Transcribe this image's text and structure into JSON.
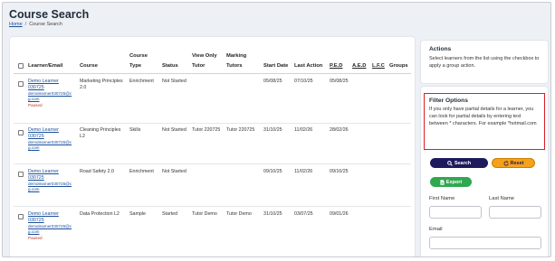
{
  "page": {
    "title": "Course Search",
    "breadcrumb": {
      "home": "Home",
      "separator": "/",
      "current": "Course Search"
    }
  },
  "table": {
    "headers": {
      "learner": "Learner/Email",
      "course": "Course",
      "course_type_1": "Course",
      "course_type_2": "Type",
      "status": "Status",
      "view_only_1": "View Only",
      "view_only_2": "Tutor",
      "marking_1": "Marking",
      "marking_2": "Tutors",
      "start_date": "Start Date",
      "last_action": "Last Action",
      "ped": "P.E.D",
      "aed": "A.E.D",
      "lfc": "L.F.C",
      "groups": "Groups"
    },
    "rows": [
      {
        "learner_name_1": "Demo Learner",
        "learner_name_2": "030725",
        "email_1": "demolearner030725@c",
        "email_2": "g.com",
        "flag": "Paused",
        "course_1": "Marketing Principles",
        "course_2": "2.0",
        "type": "Enrichment",
        "status": "Not Started",
        "view_only": "",
        "marking": "",
        "start": "05/08/25",
        "last_action": "07/10/25",
        "ped": "05/08/25",
        "aed": "",
        "lfc": "",
        "groups": ""
      },
      {
        "learner_name_1": "Demo Learner",
        "learner_name_2": "030725",
        "email_1": "demolearner030725@c",
        "email_2": "g.com",
        "flag": "",
        "course_1": "Cleaning Principles",
        "course_2": "L2",
        "type": "Skills",
        "status": "Not Started",
        "view_only": "Tutor 220725",
        "marking": "Tutor 220725",
        "start": "31/10/25",
        "last_action": "11/02/26",
        "ped": "28/02/26",
        "aed": "",
        "lfc": "",
        "groups": ""
      },
      {
        "learner_name_1": "Demo Learner",
        "learner_name_2": "030725",
        "email_1": "demolearner030725@c",
        "email_2": "g.com",
        "flag": "",
        "course_1": "Road Safety 2.0",
        "course_2": "",
        "type": "Enrichment",
        "status": "Not Started",
        "view_only": "",
        "marking": "",
        "start": "09/10/25",
        "last_action": "11/02/26",
        "ped": "09/10/25",
        "aed": "",
        "lfc": "",
        "groups": ""
      },
      {
        "learner_name_1": "Demo Learner",
        "learner_name_2": "030725",
        "email_1": "demolearner030725@c",
        "email_2": "g.com",
        "flag": "Paused",
        "course_1": "Data Protection L2",
        "course_2": "",
        "type": "Sample",
        "status": "Started",
        "view_only": "Tutor Demo",
        "marking": "Tutor Demo",
        "start": "31/10/25",
        "last_action": "03/07/25",
        "ped": "09/01/26",
        "aed": "",
        "lfc": "",
        "groups": ""
      }
    ]
  },
  "actions": {
    "title": "Actions",
    "text": "Select learners from the list using the checkbox to apply a group action."
  },
  "filter": {
    "title": "Filter Options",
    "text": "If you only have partial details for a learner, you can look for partial details by entering text between * characters. For example *hotmail.com",
    "search_label": "Search",
    "reset_label": "Reset",
    "export_label": "Export",
    "first_name_label": "First Name",
    "last_name_label": "Last Name",
    "email_label": "Email",
    "first_name_value": "",
    "last_name_value": "",
    "email_value": ""
  },
  "colors": {
    "search_btn": "#1f1a5c",
    "reset_btn": "#f6a11a",
    "export_btn": "#2fa84f",
    "highlight_border": "#d81f26",
    "paused": "#c0392b"
  }
}
